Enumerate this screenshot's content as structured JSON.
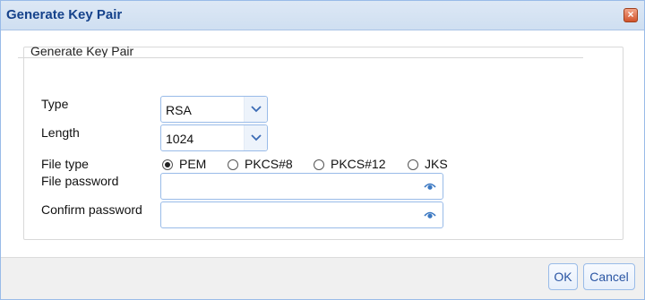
{
  "dialog": {
    "title": "Generate Key Pair",
    "close_symbol": "×"
  },
  "form": {
    "legend": "Generate Key Pair",
    "type": {
      "label": "Type",
      "value": "RSA"
    },
    "length": {
      "label": "Length",
      "value": "1024"
    },
    "file_type": {
      "label": "File type",
      "options": [
        "PEM",
        "PKCS#8",
        "PKCS#12",
        "JKS"
      ],
      "selected": "PEM"
    },
    "file_password": {
      "label": "File password",
      "value": ""
    },
    "confirm_password": {
      "label": "Confirm password",
      "value": ""
    }
  },
  "footer": {
    "ok_label": "OK",
    "cancel_label": "Cancel"
  },
  "colors": {
    "border": "#99bbe8",
    "title_text": "#15428b",
    "button_text": "#2a55a3"
  },
  "icons": {
    "dropdown": "chevron-down-icon",
    "reveal": "eye-icon",
    "close": "close-icon"
  }
}
